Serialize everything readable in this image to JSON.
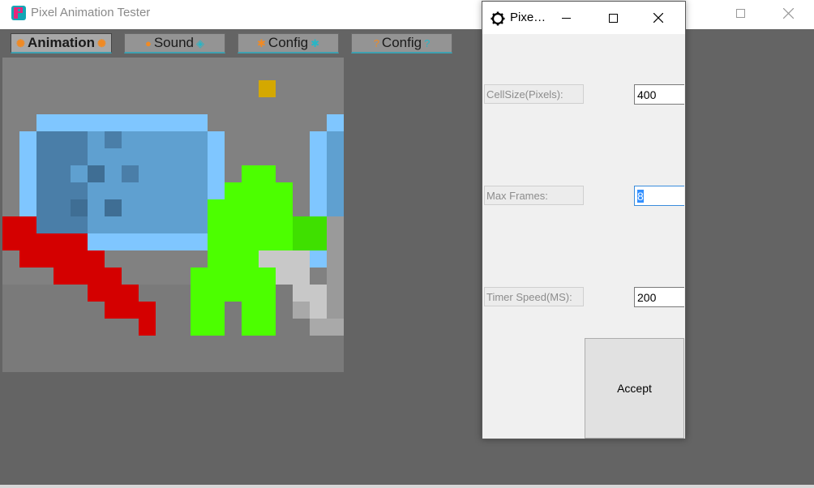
{
  "main_window": {
    "title": "Pixel Animation Tester",
    "icon": "pixel-app-icon"
  },
  "tabs": [
    {
      "label": "Animation",
      "icon": "sparkle-icon",
      "active": true
    },
    {
      "label": "Sound",
      "icon": "sound-icon",
      "active": false
    },
    {
      "label": "Config",
      "icon": "gear-icon",
      "active": false
    },
    {
      "label": "Config",
      "icon": "question-icon",
      "active": false
    }
  ],
  "dialog": {
    "title": "Pixe…",
    "icon": "gear-icon",
    "fields": {
      "cellsize": {
        "label": "CellSize(Pixels):",
        "value": "400"
      },
      "maxframes": {
        "label": "Max Frames:",
        "value": "8"
      },
      "timer": {
        "label": "Timer Speed(MS):",
        "value": "200"
      }
    },
    "accept_label": "Accept"
  },
  "colors": {
    "background": "#646464",
    "canvas": "#818181",
    "tab_underline": "#3fa0b0",
    "light_blue": "#7fc6ff",
    "steel_blue": "#5fa0d0",
    "dark_blue": "#4a7ea8",
    "red": "#d40000",
    "green": "#4cff00",
    "gold": "#d4a800",
    "light_gray": "#c8c8c8"
  }
}
